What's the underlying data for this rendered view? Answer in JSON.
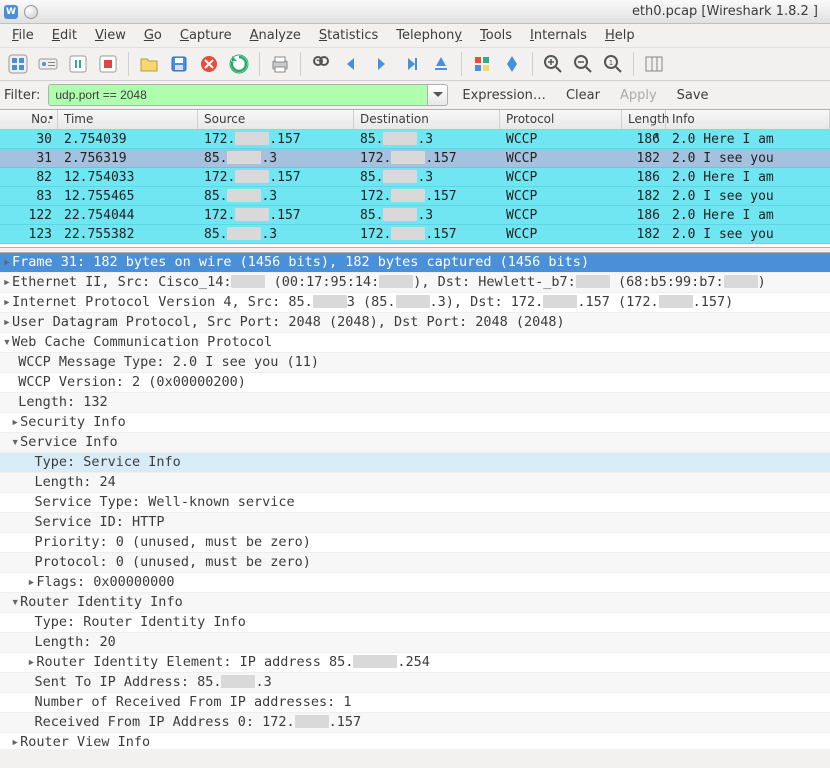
{
  "window": {
    "title": "eth0.pcap   [Wireshark  1.8.2 ]"
  },
  "menus": [
    "File",
    "Edit",
    "View",
    "Go",
    "Capture",
    "Analyze",
    "Statistics",
    "Telephony",
    "Tools",
    "Internals",
    "Help"
  ],
  "filter": {
    "label": "Filter:",
    "value": "udp.port == 2048",
    "links": {
      "expression": "Expression…",
      "clear": "Clear",
      "apply": "Apply",
      "save": "Save"
    }
  },
  "columns": {
    "no": "No.",
    "time": "Time",
    "source": "Source",
    "destination": "Destination",
    "protocol": "Protocol",
    "length": "Length",
    "info": "Info"
  },
  "packets": [
    {
      "no": "30",
      "time": "2.754039",
      "sa": "172.",
      "sb": ".157",
      "da": "85.",
      "db": ".3",
      "proto": "WCCP",
      "len": "186",
      "info": "2.0 Here I am",
      "sel": false
    },
    {
      "no": "31",
      "time": "2.756319",
      "sa": "85.",
      "sb": ".3",
      "da": "172.",
      "db": ".157",
      "proto": "WCCP",
      "len": "182",
      "info": "2.0 I see you",
      "sel": true
    },
    {
      "no": "82",
      "time": "12.754033",
      "sa": "172.",
      "sb": ".157",
      "da": "85.",
      "db": ".3",
      "proto": "WCCP",
      "len": "186",
      "info": "2.0 Here I am",
      "sel": false
    },
    {
      "no": "83",
      "time": "12.755465",
      "sa": "85.",
      "sb": ".3",
      "da": "172.",
      "db": ".157",
      "proto": "WCCP",
      "len": "182",
      "info": "2.0 I see you",
      "sel": false
    },
    {
      "no": "122",
      "time": "22.754044",
      "sa": "172.",
      "sb": ".157",
      "da": "85.",
      "db": ".3",
      "proto": "WCCP",
      "len": "186",
      "info": "2.0 Here I am",
      "sel": false
    },
    {
      "no": "123",
      "time": "22.755382",
      "sa": "85.",
      "sb": ".3",
      "da": "172.",
      "db": ".157",
      "proto": "WCCP",
      "len": "182",
      "info": "2.0 I see you",
      "sel": false
    }
  ],
  "details": {
    "frame": "Frame 31: 182 bytes on wire (1456 bits), 182 bytes captured (1456 bits)",
    "eth_a": "Ethernet II, Src: Cisco_14:",
    "eth_b": " (00:17:95:14:",
    "eth_c": "), Dst: Hewlett-_b7:",
    "eth_d": " (68:b5:99:b7:",
    "eth_e": ")",
    "ip_a": "Internet Protocol Version 4, Src: 85.",
    "ip_b": "3 (85.",
    "ip_c": ".3), Dst: 172.",
    "ip_d": ".157 (172.",
    "ip_e": ".157)",
    "udp": "User Datagram Protocol, Src Port: 2048 (2048), Dst Port: 2048 (2048)",
    "wccp": "Web Cache Communication Protocol",
    "msgtype": "WCCP Message Type: 2.0 I see you (11)",
    "ver": "WCCP Version: 2 (0x00000200)",
    "len": "Length: 132",
    "secinfo": "Security Info",
    "svcinfo": "Service Info",
    "svc_type": "Type: Service Info",
    "svc_len": "Length: 24",
    "svc_stype": "Service Type: Well-known service",
    "svc_id": "Service ID: HTTP",
    "svc_pri": "Priority: 0 (unused, must be zero)",
    "svc_proto": "Protocol: 0 (unused, must be zero)",
    "svc_flags": "Flags: 0x00000000",
    "rid": "Router Identity Info",
    "rid_type": "Type: Router Identity Info",
    "rid_len": "Length: 20",
    "rid_elem_a": "Router Identity Element: IP address 85.",
    "rid_elem_b": ".254",
    "rid_sent_a": "Sent To IP Address: 85.",
    "rid_sent_b": ".3",
    "rid_nrecv": "Number of Received From IP addresses: 1",
    "rid_recv_a": "Received From IP Address 0: 172.",
    "rid_recv_b": ".157",
    "rvi": "Router View Info"
  }
}
